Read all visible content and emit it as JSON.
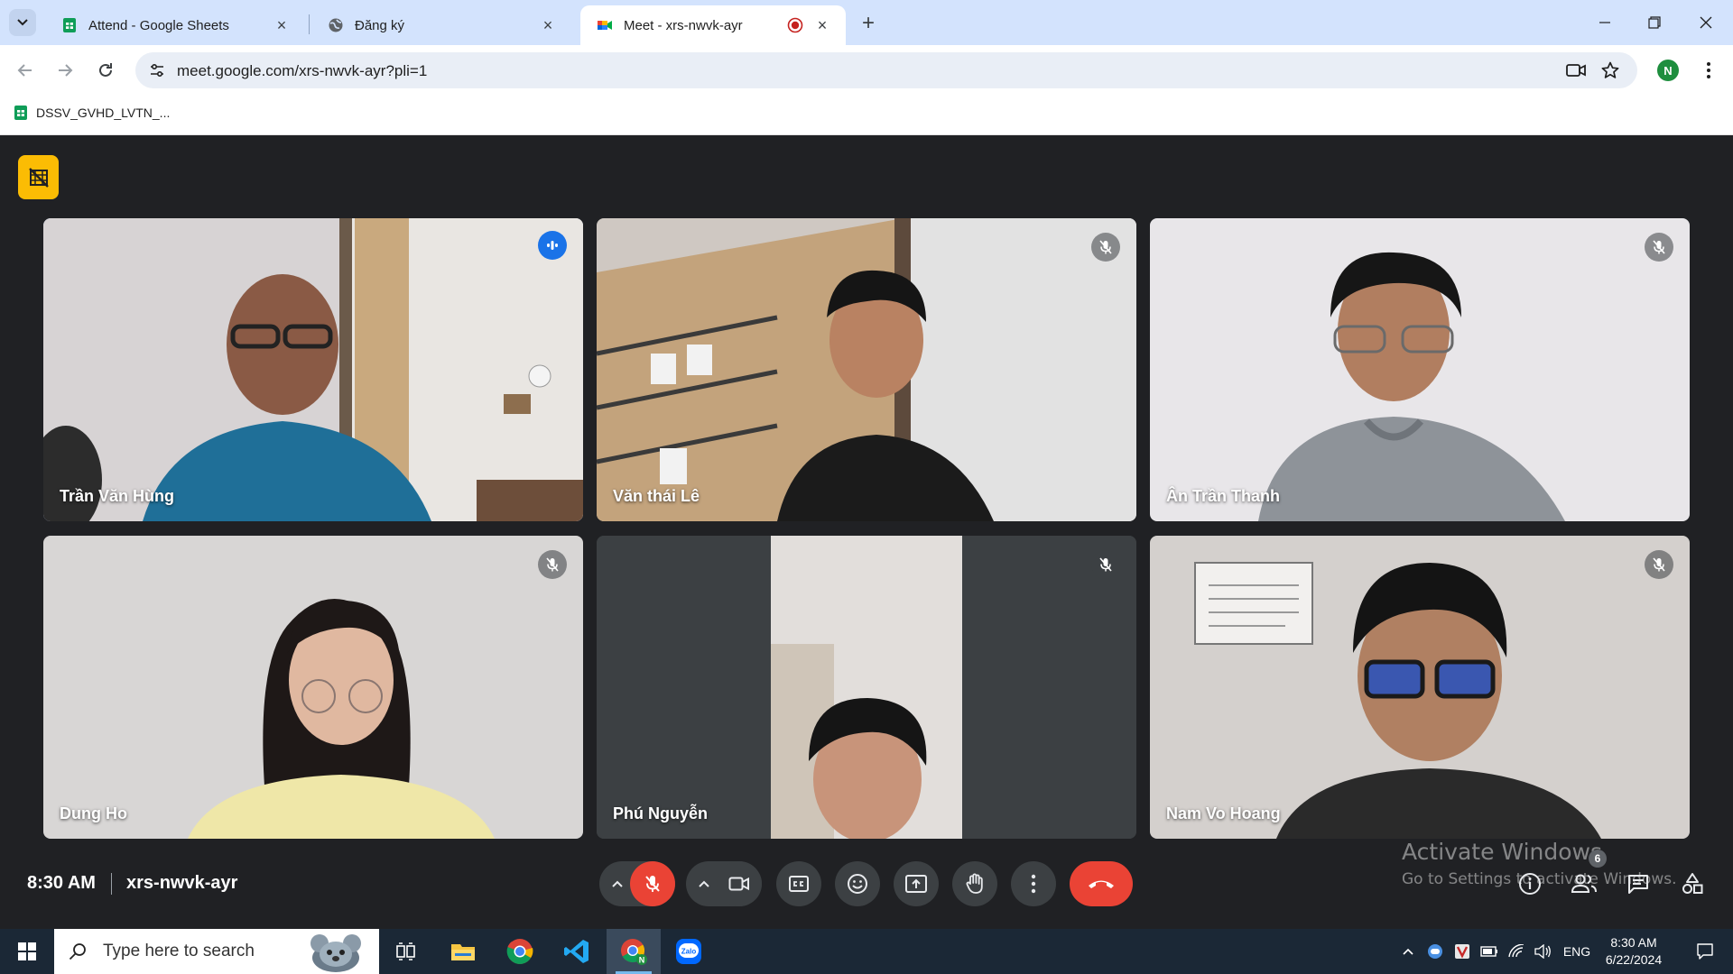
{
  "browser": {
    "tabs": [
      {
        "title": "Attend - Google Sheets",
        "icon": "google-sheets-icon",
        "active": false
      },
      {
        "title": "Đăng ký",
        "icon": "globe-icon",
        "active": false
      },
      {
        "title": "Meet - xrs-nwvk-ayr",
        "icon": "google-meet-icon",
        "active": true,
        "recording": true
      }
    ],
    "url": "meet.google.com/xrs-nwvk-ayr?pli=1",
    "profile_initial": "N",
    "bookmarks": [
      {
        "label": "DSSV_GVHD_LVTN_...",
        "icon": "google-sheets-icon"
      }
    ]
  },
  "meet": {
    "participants": [
      {
        "name": "Trần Văn Hùng",
        "muted": false,
        "speaking": true
      },
      {
        "name": "Văn thái Lê",
        "muted": true,
        "speaking": false
      },
      {
        "name": "Ân Trần Thanh",
        "muted": true,
        "speaking": false
      },
      {
        "name": "Dung Ho",
        "muted": true,
        "speaking": false
      },
      {
        "name": "Phú Nguyễn",
        "muted": true,
        "speaking": false
      },
      {
        "name": "Nam Vo Hoang",
        "muted": true,
        "speaking": false
      }
    ],
    "time": "8:30 AM",
    "meeting_code": "xrs-nwvk-ayr",
    "people_count": "6",
    "mic_state": "off",
    "colors": {
      "accent": "#1a73e8",
      "danger": "#ea4335",
      "background": "#202124",
      "control": "#3c4043"
    }
  },
  "watermark": {
    "title": "Activate Windows",
    "subtitle": "Go to Settings to activate Windows."
  },
  "taskbar": {
    "search_placeholder": "Type here to search",
    "language": "ENG",
    "time": "8:30 AM",
    "date": "6/22/2024",
    "apps": [
      "task-view-icon",
      "file-explorer-icon",
      "chrome-icon",
      "vscode-icon",
      "chrome-profile-icon",
      "zalo-icon"
    ]
  }
}
